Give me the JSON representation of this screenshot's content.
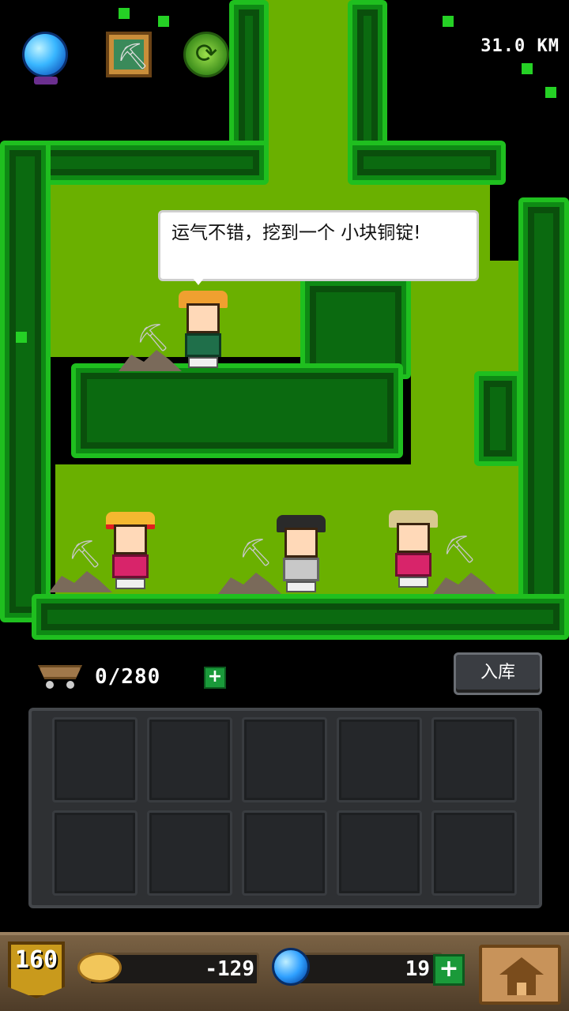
{
  "hud": {
    "distance": "31.0 KM",
    "icons": [
      "crystal-ball-icon",
      "pickaxe-card-icon",
      "refresh-coin-icon"
    ]
  },
  "speech_bubble": {
    "text": "运气不错，挖到一个 小块铜锭!"
  },
  "miners": [
    {
      "name": "miner-top",
      "hat_color": "#f0a030"
    },
    {
      "name": "miner-straw-hat",
      "hat_color": "#f5b830"
    },
    {
      "name": "miner-dark-hair",
      "hat_color": "#2a2a2a"
    },
    {
      "name": "miner-sun-hat",
      "hat_color": "#d8c890"
    }
  ],
  "inventory": {
    "capacity": "0/280",
    "plus_label": "+",
    "store_label": "入库",
    "slots": 10
  },
  "bottom_bar": {
    "level": "160",
    "gold": "-129",
    "gems": "19",
    "gem_plus_label": "+"
  },
  "colors": {
    "grass": "#6ab000",
    "hedge_light": "#1fbf1f",
    "hedge_dark": "#0b6a10",
    "accent_green": "#1a9a3a"
  }
}
